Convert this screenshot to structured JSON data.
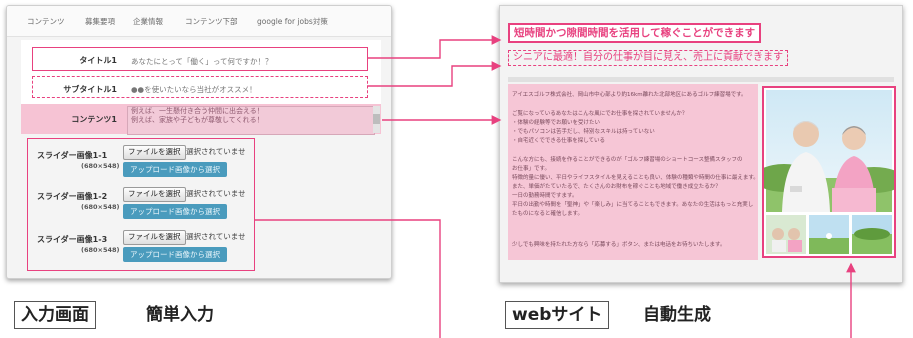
{
  "input_screen": {
    "tabs": [
      "コンテンツ",
      "募集要項",
      "企業情報",
      "コンテンツ下部",
      "google for jobs対策"
    ],
    "fields": {
      "title": {
        "label": "タイトル1",
        "value": "あなたにとって「働く」って何ですか！？"
      },
      "subtitle": {
        "label": "サブタイトル1",
        "value": "●●を使いたいなら当社がオススメ！"
      },
      "content": {
        "label": "コンテンツ1",
        "lines": [
          "",
          "例えば、一生懸付き合う仲間に出会える！",
          "例えば、家族や子どもが尊敬してくれる！"
        ]
      }
    },
    "sliders": [
      {
        "label": "スライダー画像1-1",
        "size": "(680×548)"
      },
      {
        "label": "スライダー画像1-2",
        "size": "(680×548)"
      },
      {
        "label": "スライダー画像1-3",
        "size": "(680×548)"
      }
    ],
    "file_button_label": "ファイルを選択",
    "no_file_text": "選択されていませ",
    "upload_button_label": "アップロード画像から選択"
  },
  "website": {
    "title": "短時間かつ隙間時間を活用して稼ぐことができます",
    "subtitle": "シニアに最適！自分の仕事が目に見え、売上に貢献できます",
    "body_lines": [
      "アイエスゴルフ株式会社、岡山市中心部より約16km離れた北部地区にあるゴルフ練習場です。",
      "",
      "ご覧になっているあなたはこんな風にでお仕事を探されていませんか？",
      "・体験の経験等でお願いを受けたい",
      "・でもパソコンは苦手だし、特別なスキルは持っていない",
      "・自宅近くでできる仕事を探している",
      "",
      "こんな方にも、接続を作ることができるのが「ゴルフ練習場のショートコース整備スタッフの",
      "お仕事」です。",
      "特徴的量に優い、平日やライフスタイルを見えることも良い、体験の種類や時間の仕事に最えます。",
      "また、単価がたていたるで、たくさんのお財布を稼ぐことも地域で働き成立たるか？",
      "一日の勤務時間ですます。",
      "平日の出勤や時間を「聖神」や「楽しみ」に当てることもできます。あなたの生活はもっと充実し",
      "たものになると確信します。",
      "",
      "少しでも興味を持たれた方なら「応募する」ボタン、または电话をお待ちいたします。"
    ]
  },
  "captions": {
    "input_box": "入力画面",
    "input_text": "簡単入力",
    "web_box": "webサイト",
    "web_text": "自動生成"
  },
  "colors": {
    "accent": "#e8417f",
    "button_blue": "#4a9bbd",
    "content_pink": "#f6c6d6"
  }
}
